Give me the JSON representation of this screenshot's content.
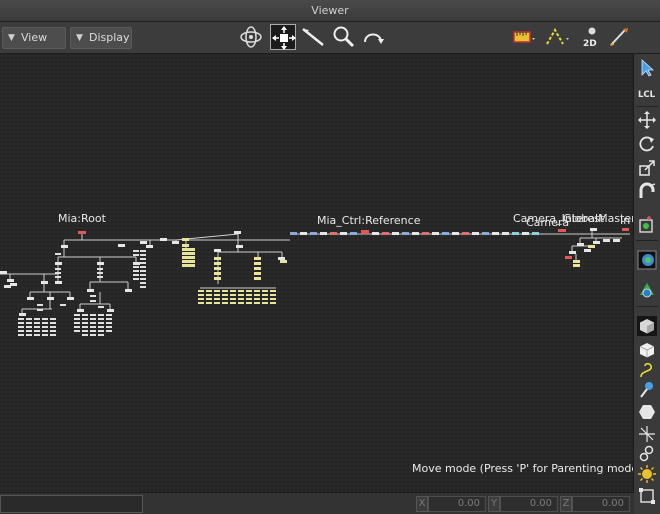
{
  "window": {
    "title": "Viewer"
  },
  "toolbar": {
    "view_label": "View",
    "display_label": "Display",
    "tools": [
      "orbit-icon",
      "move-view-icon",
      "pick-icon",
      "zoom-icon",
      "undo-icon"
    ],
    "right_tools": [
      "ruler-icon",
      "curve-icon",
      "2d-icon",
      "brush-icon"
    ],
    "label_2d": "2D"
  },
  "viewport": {
    "nodes": [
      {
        "label": "Mia:Root"
      },
      {
        "label": "Mia_Ctrl:Reference"
      },
      {
        "label": "Camera_Interest"
      },
      {
        "label": "Camera"
      },
      {
        "label": "GlobalMaster"
      },
      {
        "label": "In"
      }
    ],
    "mode_text": "Move mode (Press 'P' for Parenting mode)"
  },
  "rightbar": {
    "tools": [
      "select-arrow-icon",
      "lcl-icon",
      "translate-icon",
      "rotate-icon",
      "scale-icon",
      "magnet-icon",
      "add-node-icon",
      "render-region-icon",
      "texture-icon",
      "shaded-cube-icon",
      "wire-cube-icon",
      "curve-tool-icon",
      "light-icon",
      "polygon-icon",
      "axis-icon",
      "hierarchy-icon",
      "sun-icon",
      "frame-icon"
    ],
    "lcl_label": "LCL"
  },
  "statusbar": {
    "coords": [
      {
        "axis": "X",
        "value": "0.00"
      },
      {
        "axis": "Y",
        "value": "0.00"
      },
      {
        "axis": "Z",
        "value": "0.00"
      }
    ]
  },
  "colors": {
    "background": "#262626",
    "node_white": "#e6e6e6",
    "node_yellow": "#e8e49a",
    "node_red": "#e05858",
    "node_blue": "#8aa8e0"
  }
}
